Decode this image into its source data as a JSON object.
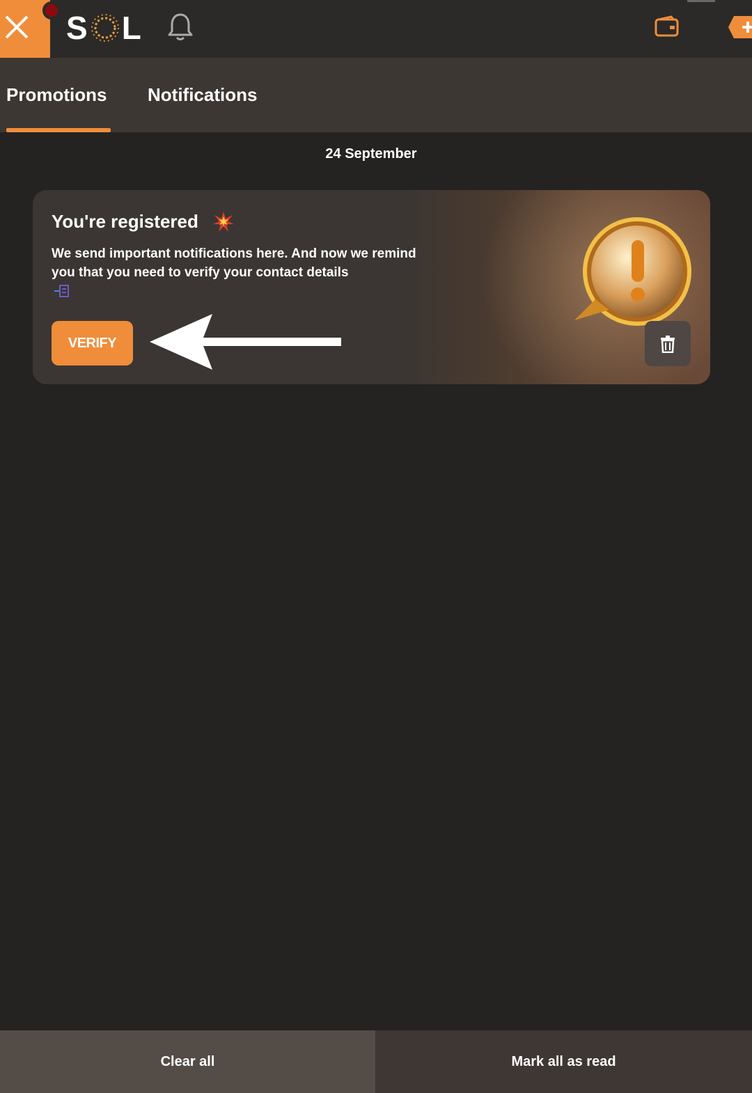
{
  "header": {
    "logo_text_left": "S",
    "logo_text_right": "L",
    "icons": [
      "close-icon",
      "bell-icon",
      "wallet-icon",
      "plus-icon"
    ]
  },
  "tabs": [
    {
      "label": "Promotions",
      "active": true
    },
    {
      "label": "Notifications",
      "active": false
    }
  ],
  "date": "24 September",
  "card": {
    "title": "You're registered",
    "text": "We send important notifications here. And now we remind you that you need to verify your contact details",
    "verify_label": "VERIFY"
  },
  "footer": {
    "clear_label": "Clear all",
    "mark_label": "Mark all as read"
  },
  "colors": {
    "accent": "#f08d3a",
    "background": "#242322",
    "tabs_bg": "#3d3733"
  }
}
